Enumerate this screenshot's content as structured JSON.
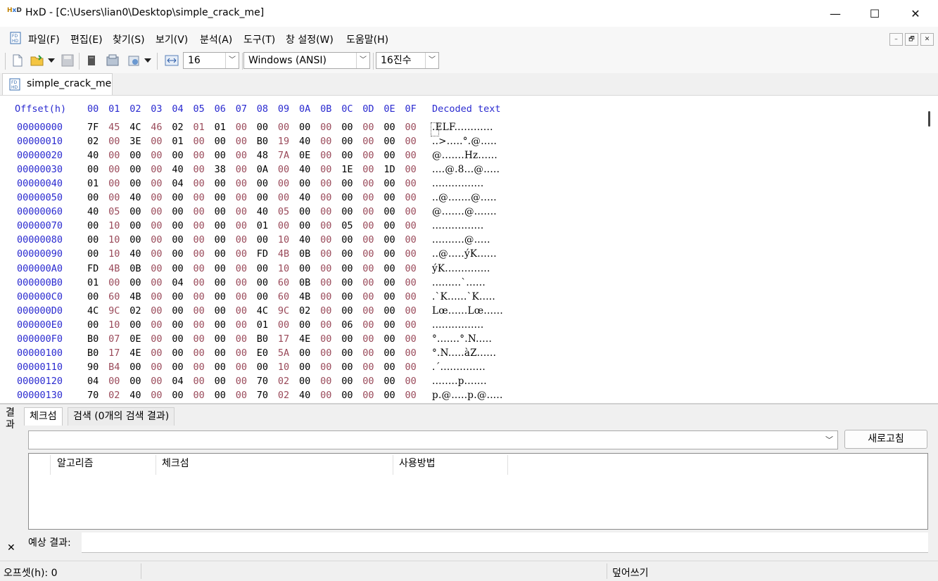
{
  "window": {
    "title": "HxD - [C:\\Users\\lian0\\Desktop\\simple_crack_me]",
    "minimize": "—",
    "maximize": "☐",
    "close": "✕"
  },
  "menu": [
    "파일(F)",
    "편집(E)",
    "찾기(S)",
    "보기(V)",
    "분석(A)",
    "도구(T)",
    "창 설정(W)",
    "도움말(H)"
  ],
  "mdi_buttons": [
    "–",
    "🗗",
    "✕"
  ],
  "toolbar": {
    "bytes_per_row": "16",
    "charset": "Windows (ANSI)",
    "offset_base": "16진수"
  },
  "tab": {
    "label": "simple_crack_me"
  },
  "hex": {
    "header_offset": "Offset(h)",
    "header_cols": [
      "00",
      "01",
      "02",
      "03",
      "04",
      "05",
      "06",
      "07",
      "08",
      "09",
      "0A",
      "0B",
      "0C",
      "0D",
      "0E",
      "0F"
    ],
    "header_decoded": "Decoded text",
    "rows": [
      {
        "offset": "00000000",
        "bytes": [
          "7F",
          "45",
          "4C",
          "46",
          "02",
          "01",
          "01",
          "00",
          "00",
          "00",
          "00",
          "00",
          "00",
          "00",
          "00",
          "00"
        ],
        "text": ".ELF............"
      },
      {
        "offset": "00000010",
        "bytes": [
          "02",
          "00",
          "3E",
          "00",
          "01",
          "00",
          "00",
          "00",
          "B0",
          "19",
          "40",
          "00",
          "00",
          "00",
          "00",
          "00"
        ],
        "text": "..>.....°.@....."
      },
      {
        "offset": "00000020",
        "bytes": [
          "40",
          "00",
          "00",
          "00",
          "00",
          "00",
          "00",
          "00",
          "48",
          "7A",
          "0E",
          "00",
          "00",
          "00",
          "00",
          "00"
        ],
        "text": "@.......Hz......"
      },
      {
        "offset": "00000030",
        "bytes": [
          "00",
          "00",
          "00",
          "00",
          "40",
          "00",
          "38",
          "00",
          "0A",
          "00",
          "40",
          "00",
          "1E",
          "00",
          "1D",
          "00"
        ],
        "text": "....@.8...@....."
      },
      {
        "offset": "00000040",
        "bytes": [
          "01",
          "00",
          "00",
          "00",
          "04",
          "00",
          "00",
          "00",
          "00",
          "00",
          "00",
          "00",
          "00",
          "00",
          "00",
          "00"
        ],
        "text": "................"
      },
      {
        "offset": "00000050",
        "bytes": [
          "00",
          "00",
          "40",
          "00",
          "00",
          "00",
          "00",
          "00",
          "00",
          "00",
          "40",
          "00",
          "00",
          "00",
          "00",
          "00"
        ],
        "text": "..@.......@....."
      },
      {
        "offset": "00000060",
        "bytes": [
          "40",
          "05",
          "00",
          "00",
          "00",
          "00",
          "00",
          "00",
          "40",
          "05",
          "00",
          "00",
          "00",
          "00",
          "00",
          "00"
        ],
        "text": "@.......@......."
      },
      {
        "offset": "00000070",
        "bytes": [
          "00",
          "10",
          "00",
          "00",
          "00",
          "00",
          "00",
          "00",
          "01",
          "00",
          "00",
          "00",
          "05",
          "00",
          "00",
          "00"
        ],
        "text": "................"
      },
      {
        "offset": "00000080",
        "bytes": [
          "00",
          "10",
          "00",
          "00",
          "00",
          "00",
          "00",
          "00",
          "00",
          "10",
          "40",
          "00",
          "00",
          "00",
          "00",
          "00"
        ],
        "text": "..........@....."
      },
      {
        "offset": "00000090",
        "bytes": [
          "00",
          "10",
          "40",
          "00",
          "00",
          "00",
          "00",
          "00",
          "FD",
          "4B",
          "0B",
          "00",
          "00",
          "00",
          "00",
          "00"
        ],
        "text": "..@.....ýK......"
      },
      {
        "offset": "000000A0",
        "bytes": [
          "FD",
          "4B",
          "0B",
          "00",
          "00",
          "00",
          "00",
          "00",
          "00",
          "10",
          "00",
          "00",
          "00",
          "00",
          "00",
          "00"
        ],
        "text": "ýK.............."
      },
      {
        "offset": "000000B0",
        "bytes": [
          "01",
          "00",
          "00",
          "00",
          "04",
          "00",
          "00",
          "00",
          "00",
          "60",
          "0B",
          "00",
          "00",
          "00",
          "00",
          "00"
        ],
        "text": ".........`......"
      },
      {
        "offset": "000000C0",
        "bytes": [
          "00",
          "60",
          "4B",
          "00",
          "00",
          "00",
          "00",
          "00",
          "00",
          "60",
          "4B",
          "00",
          "00",
          "00",
          "00",
          "00"
        ],
        "text": ".`K......`K....."
      },
      {
        "offset": "000000D0",
        "bytes": [
          "4C",
          "9C",
          "02",
          "00",
          "00",
          "00",
          "00",
          "00",
          "4C",
          "9C",
          "02",
          "00",
          "00",
          "00",
          "00",
          "00"
        ],
        "text": "Lœ......Lœ......"
      },
      {
        "offset": "000000E0",
        "bytes": [
          "00",
          "10",
          "00",
          "00",
          "00",
          "00",
          "00",
          "00",
          "01",
          "00",
          "00",
          "00",
          "06",
          "00",
          "00",
          "00"
        ],
        "text": "................"
      },
      {
        "offset": "000000F0",
        "bytes": [
          "B0",
          "07",
          "0E",
          "00",
          "00",
          "00",
          "00",
          "00",
          "B0",
          "17",
          "4E",
          "00",
          "00",
          "00",
          "00",
          "00"
        ],
        "text": "°.......°.N....."
      },
      {
        "offset": "00000100",
        "bytes": [
          "B0",
          "17",
          "4E",
          "00",
          "00",
          "00",
          "00",
          "00",
          "E0",
          "5A",
          "00",
          "00",
          "00",
          "00",
          "00",
          "00"
        ],
        "text": "°.N.....àZ......"
      },
      {
        "offset": "00000110",
        "bytes": [
          "90",
          "B4",
          "00",
          "00",
          "00",
          "00",
          "00",
          "00",
          "00",
          "10",
          "00",
          "00",
          "00",
          "00",
          "00",
          "00"
        ],
        "text": ".´.............."
      },
      {
        "offset": "00000120",
        "bytes": [
          "04",
          "00",
          "00",
          "00",
          "04",
          "00",
          "00",
          "00",
          "70",
          "02",
          "00",
          "00",
          "00",
          "00",
          "00",
          "00"
        ],
        "text": "........p......."
      },
      {
        "offset": "00000130",
        "bytes": [
          "70",
          "02",
          "40",
          "00",
          "00",
          "00",
          "00",
          "00",
          "70",
          "02",
          "40",
          "00",
          "00",
          "00",
          "00",
          "00"
        ],
        "text": "p.@.....p.@....."
      }
    ]
  },
  "results": {
    "vertical_label": [
      "결",
      "과"
    ],
    "close": "✕",
    "tabs": [
      "체크섬",
      "검색 (0개의 검색 결과)"
    ],
    "refresh_button": "새로고침",
    "columns": [
      "알고리즘",
      "체크섬",
      "사용방법"
    ],
    "expected_label": "예상 결과:"
  },
  "status": {
    "offset": "오프셋(h): 0",
    "mode": "덮어쓰기"
  }
}
